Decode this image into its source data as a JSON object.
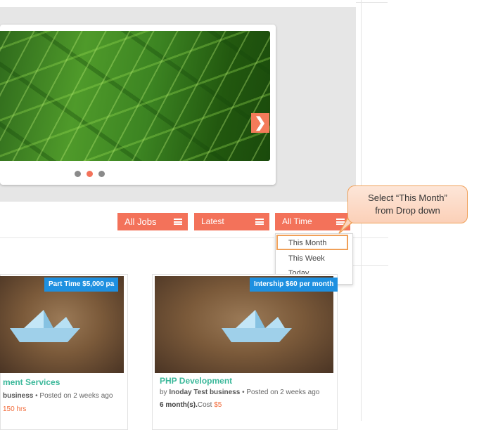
{
  "filters": {
    "all_jobs": "All Jobs",
    "latest": "Latest",
    "all_time": "All Time"
  },
  "dropdown_options": [
    "This Month",
    "This Week",
    "Today"
  ],
  "callout": {
    "line1": "Select “This Month”",
    "line2": "from Drop down"
  },
  "cards": [
    {
      "badge": "Part Time $5,000 pa",
      "title": "ment Services",
      "author": "business",
      "posted": "Posted on 2 weeks ago",
      "extra": "150 hrs"
    },
    {
      "badge": "Intership $60 per month",
      "title": "PHP Development",
      "by": "by",
      "author": "Inoday Test business",
      "posted": "Posted on 2 weeks ago",
      "duration": "6 month(s).",
      "cost_label": "Cost",
      "cost": "$5"
    }
  ],
  "colors": {
    "accent": "#f3725a",
    "badge": "#1e90e0",
    "title": "#3bb89a",
    "highlight": "#f0a058"
  }
}
